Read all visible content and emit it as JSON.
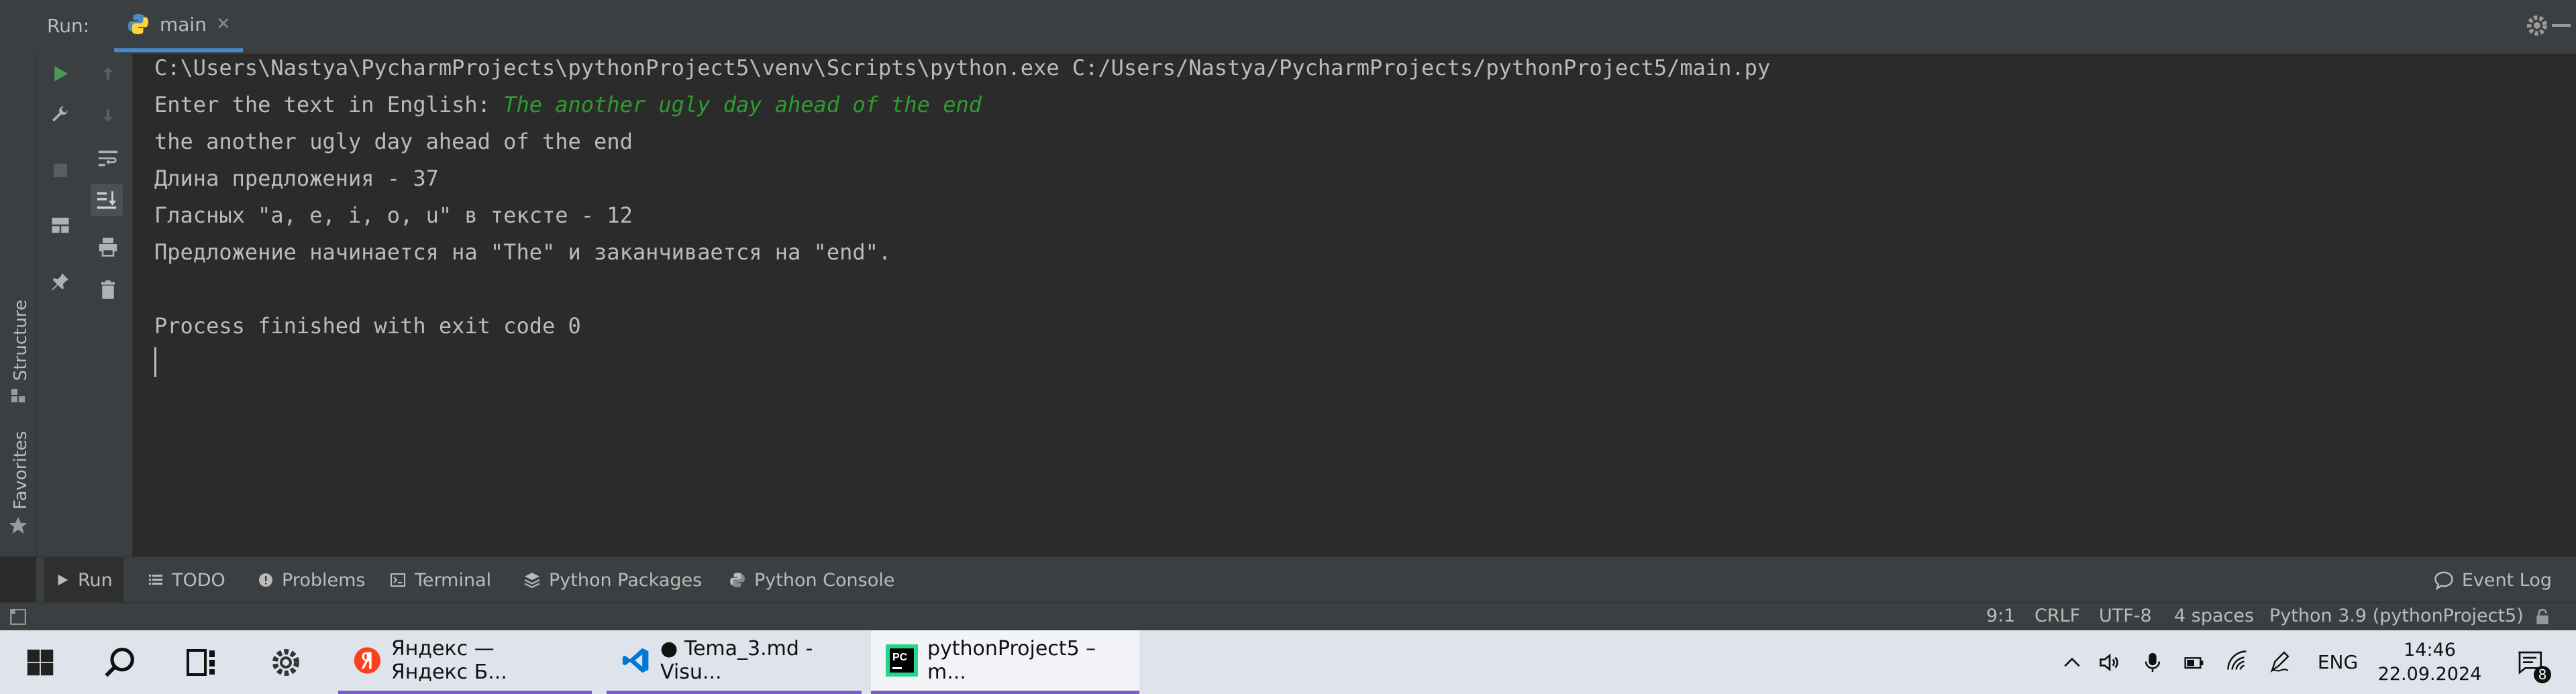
{
  "run_header": {
    "run_label": "Run:",
    "tab_label": "main",
    "tab_close": "✕"
  },
  "console": {
    "lines": [
      "C:\\Users\\Nastya\\PycharmProjects\\pythonProject5\\venv\\Scripts\\python.exe C:/Users/Nastya/PycharmProjects/pythonProject5/main.py",
      "Enter the text in English: ",
      "the another ugly day ahead of the end",
      "Длина предложения - 37",
      "Гласных \"a, e, i, o, u\" в тексте - 12",
      "Предложение начинается на \"The\" и заканчивается на \"end\".",
      "",
      "Process finished with exit code 0"
    ],
    "user_input": "The another ugly day ahead of the end"
  },
  "side_labels": {
    "structure": "Structure",
    "favorites": "Favorites"
  },
  "bottom_tabs": [
    {
      "label": "Run",
      "icon": "play-icon"
    },
    {
      "label": "TODO",
      "icon": "list-icon"
    },
    {
      "label": "Problems",
      "icon": "alert-icon"
    },
    {
      "label": "Terminal",
      "icon": "terminal-icon"
    },
    {
      "label": "Python Packages",
      "icon": "layers-icon"
    },
    {
      "label": "Python Console",
      "icon": "python-icon"
    }
  ],
  "event_log": "Event Log",
  "status": {
    "position": "9:1",
    "line_sep": "CRLF",
    "encoding": "UTF-8",
    "indent": "4 spaces",
    "interpreter": "Python 3.9 (pythonProject5)"
  },
  "taskbar": {
    "apps": [
      {
        "label": "Яндекс — Яндекс Б...",
        "icon": "yandex-icon"
      },
      {
        "label": "● Tema_3.md - Visu...",
        "icon": "vscode-icon"
      },
      {
        "label": "pythonProject5 – m...",
        "icon": "pycharm-icon"
      }
    ],
    "language": "ENG",
    "time": "14:46",
    "date": "22.09.2024",
    "notifications": "8"
  },
  "colors": {
    "console_bg": "#2b2b2b",
    "panel_bg": "#3c3f41",
    "input_green": "#2e9c2e",
    "run_green": "#499c54",
    "taskbar_bg": "#dfe3ec",
    "accent_purple": "#7a5cc8"
  }
}
